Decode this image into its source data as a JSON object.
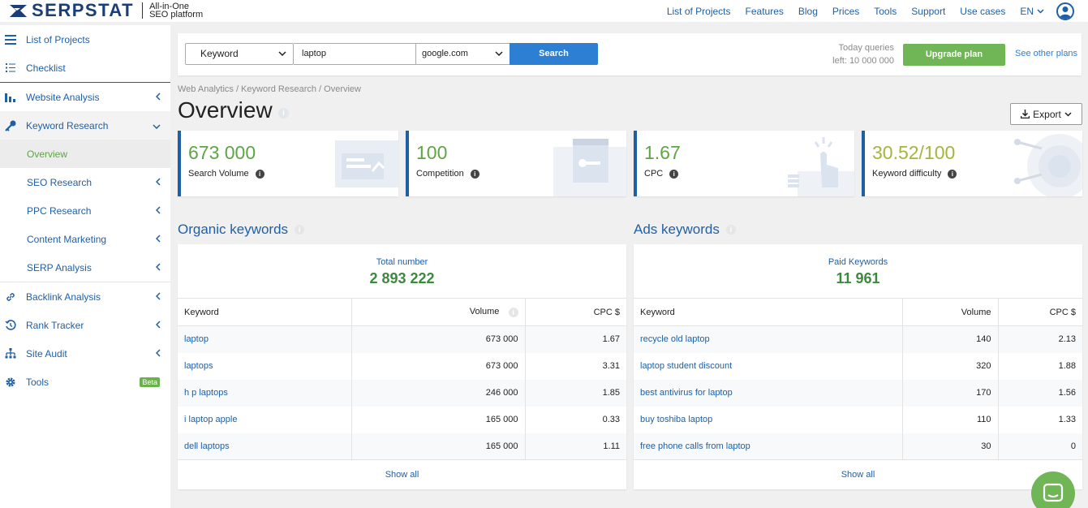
{
  "brand": {
    "name": "SERPSTAT",
    "tagline_1": "All-in-One",
    "tagline_2": "SEO platform"
  },
  "topnav": {
    "links": [
      "List of Projects",
      "Features",
      "Blog",
      "Prices",
      "Tools",
      "Support",
      "Use cases"
    ],
    "lang": "EN"
  },
  "sidebar": {
    "items": [
      {
        "label": "List of Projects",
        "icon": "hamburger-icon"
      },
      {
        "label": "Checklist",
        "icon": "checklist-icon"
      },
      {
        "label": "Website Analysis",
        "icon": "bar-chart-icon"
      },
      {
        "label": "Keyword Research",
        "icon": "key-icon"
      },
      {
        "label": "Overview"
      },
      {
        "label": "SEO Research"
      },
      {
        "label": "PPC Research"
      },
      {
        "label": "Content Marketing"
      },
      {
        "label": "SERP Analysis"
      },
      {
        "label": "Backlink Analysis",
        "icon": "link-icon"
      },
      {
        "label": "Rank Tracker",
        "icon": "history-icon"
      },
      {
        "label": "Site Audit",
        "icon": "sitemap-icon"
      },
      {
        "label": "Tools",
        "icon": "gear-icon",
        "badge": "Beta"
      }
    ]
  },
  "search": {
    "type": "Keyword",
    "query": "laptop",
    "database": "google.com",
    "button": "Search",
    "queries_line1": "Today queries",
    "queries_line2": "left: 10 000 000",
    "upgrade": "Upgrade plan",
    "other_plans": "See other plans"
  },
  "breadcrumb": "Web Analytics / Keyword Research / Overview",
  "page_title": "Overview",
  "export": "Export",
  "kpis": [
    {
      "value": "673 000",
      "label": "Search Volume"
    },
    {
      "value": "100",
      "label": "Competition"
    },
    {
      "value": "1.67",
      "label": "CPC"
    },
    {
      "value": "30.52/100",
      "label": "Keyword difficulty"
    }
  ],
  "organic": {
    "title": "Organic keywords",
    "total_label": "Total number",
    "total_value": "2 893 222",
    "headers": [
      "Keyword",
      "Volume",
      "CPC $"
    ],
    "rows": [
      [
        "laptop",
        "673 000",
        "1.67"
      ],
      [
        "laptops",
        "673 000",
        "3.31"
      ],
      [
        "h p laptops",
        "246 000",
        "1.85"
      ],
      [
        "i laptop apple",
        "165 000",
        "0.33"
      ],
      [
        "dell laptops",
        "165 000",
        "1.11"
      ]
    ],
    "show_all": "Show all"
  },
  "ads": {
    "title": "Ads keywords",
    "total_label": "Paid Keywords",
    "total_value": "11 961",
    "headers": [
      "Keyword",
      "Volume",
      "CPC $"
    ],
    "rows": [
      [
        "recycle old laptop",
        "140",
        "2.13"
      ],
      [
        "laptop student discount",
        "320",
        "1.88"
      ],
      [
        "best antivirus for laptop",
        "170",
        "1.56"
      ],
      [
        "buy toshiba laptop",
        "110",
        "1.33"
      ],
      [
        "free phone calls from laptop",
        "30",
        "0"
      ]
    ],
    "show_all": "Show all"
  },
  "colors": {
    "accent": "#1f5fa6",
    "green": "#70b556",
    "kpi_green": "#5ea543",
    "kpi_olive": "#a5b53b"
  }
}
